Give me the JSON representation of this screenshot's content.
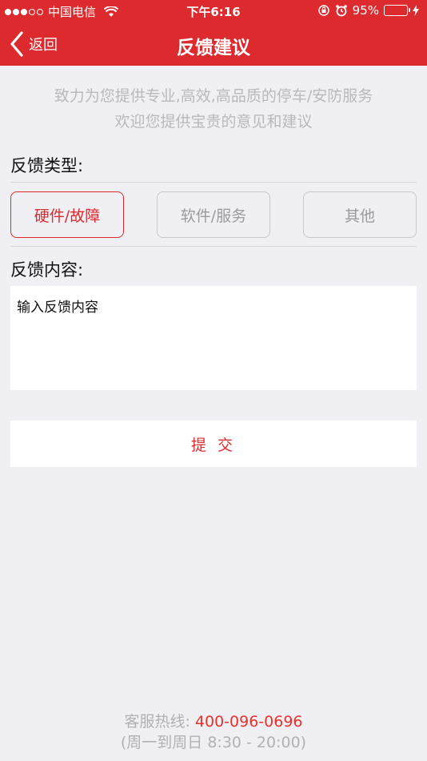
{
  "status_bar": {
    "carrier": "中国电信",
    "time": "下午6:16",
    "battery_percent": "95%",
    "battery_level": 0.95,
    "battery_color": "#4cd964"
  },
  "nav": {
    "back_label": "返回",
    "title": "反馈建议"
  },
  "intro": {
    "line1": "致力为您提供专业,高效,高品质的停车/安防服务",
    "line2": "欢迎您提供宝贵的意见和建议"
  },
  "feedback_type": {
    "label": "反馈类型:",
    "options": [
      "硬件/故障",
      "软件/服务",
      "其他"
    ],
    "selected": "硬件/故障"
  },
  "feedback_content": {
    "label": "反馈内容:",
    "placeholder": "输入反馈内容"
  },
  "submit_label": "提 交",
  "footer": {
    "hotline_label": "客服热线: ",
    "hotline_number": "400-096-0696",
    "hours": "(周一到周日 8:30 - 20:00)"
  },
  "colors": {
    "brand": "#dc2a2e",
    "background": "#efeff4",
    "hotline": "#e8322c"
  },
  "icons": [
    "signal-icon",
    "wifi-icon",
    "lock-rotation-icon",
    "alarm-icon",
    "battery-icon",
    "charging-icon",
    "back-chevron-icon"
  ]
}
